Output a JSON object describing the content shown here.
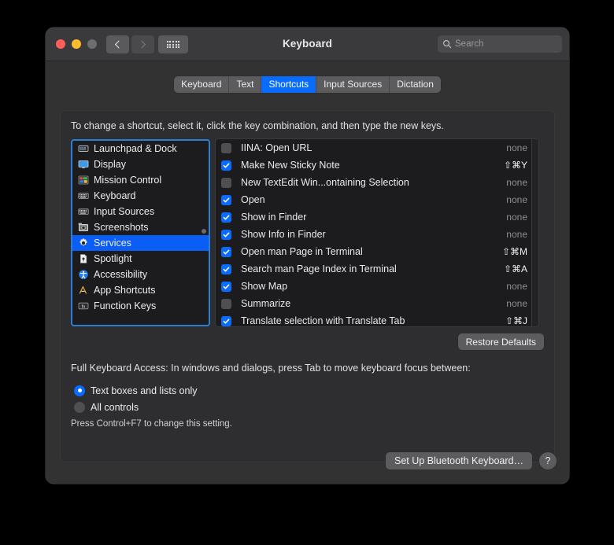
{
  "window": {
    "title": "Keyboard",
    "traffic_lights": [
      "close",
      "minimize",
      "zoom"
    ],
    "nav_back": "back-chevron",
    "nav_forward": "forward-chevron",
    "grid_button": "show-all-preferences"
  },
  "search": {
    "placeholder": "Search",
    "value": ""
  },
  "tabs": [
    {
      "label": "Keyboard",
      "active": false
    },
    {
      "label": "Text",
      "active": false
    },
    {
      "label": "Shortcuts",
      "active": true
    },
    {
      "label": "Input Sources",
      "active": false
    },
    {
      "label": "Dictation",
      "active": false
    }
  ],
  "hint": "To change a shortcut, select it, click the key combination, and then type the new keys.",
  "sidebar": {
    "items": [
      {
        "label": "Launchpad & Dock",
        "icon": "launchpad-icon",
        "selected": false
      },
      {
        "label": "Display",
        "icon": "display-icon",
        "selected": false
      },
      {
        "label": "Mission Control",
        "icon": "mission-control-icon",
        "selected": false
      },
      {
        "label": "Keyboard",
        "icon": "keyboard-icon",
        "selected": false
      },
      {
        "label": "Input Sources",
        "icon": "input-sources-icon",
        "selected": false
      },
      {
        "label": "Screenshots",
        "icon": "screenshots-icon",
        "selected": false
      },
      {
        "label": "Services",
        "icon": "gear-icon",
        "selected": true
      },
      {
        "label": "Spotlight",
        "icon": "spotlight-document-icon",
        "selected": false
      },
      {
        "label": "Accessibility",
        "icon": "accessibility-icon",
        "selected": false
      },
      {
        "label": "App Shortcuts",
        "icon": "app-shortcuts-icon",
        "selected": false
      },
      {
        "label": "Function Keys",
        "icon": "fn-key-icon",
        "selected": false
      }
    ]
  },
  "shortcuts": {
    "rows": [
      {
        "checked": false,
        "name": "IINA: Open URL",
        "value": "none",
        "assigned": false
      },
      {
        "checked": true,
        "name": "Make New Sticky Note",
        "value": "⇧⌘Y",
        "assigned": true
      },
      {
        "checked": false,
        "name": "New TextEdit Win...ontaining Selection",
        "value": "none",
        "assigned": false
      },
      {
        "checked": true,
        "name": "Open",
        "value": "none",
        "assigned": false
      },
      {
        "checked": true,
        "name": "Show in Finder",
        "value": "none",
        "assigned": false
      },
      {
        "checked": true,
        "name": "Show Info in Finder",
        "value": "none",
        "assigned": false
      },
      {
        "checked": true,
        "name": "Open man Page in Terminal",
        "value": "⇧⌘M",
        "assigned": true
      },
      {
        "checked": true,
        "name": "Search man Page Index in Terminal",
        "value": "⇧⌘A",
        "assigned": true
      },
      {
        "checked": true,
        "name": "Show Map",
        "value": "none",
        "assigned": false
      },
      {
        "checked": false,
        "name": "Summarize",
        "value": "none",
        "assigned": false
      },
      {
        "checked": true,
        "name": "Translate selection with Translate Tab",
        "value": "⇧⌘J",
        "assigned": true
      }
    ]
  },
  "restore_defaults_label": "Restore Defaults",
  "full_keyboard_access": {
    "heading": "Full Keyboard Access: In windows and dialogs, press Tab to move keyboard focus between:",
    "options": [
      {
        "label": "Text boxes and lists only",
        "selected": true
      },
      {
        "label": "All controls",
        "selected": false
      }
    ],
    "note": "Press Control+F7 to change this setting."
  },
  "footer": {
    "bluetooth_label": "Set Up Bluetooth Keyboard…",
    "help_label": "?"
  },
  "colors": {
    "accent": "#0a6cff",
    "selection": "#0a5ef5",
    "focus_ring": "#2b7ed8",
    "window_bg": "#323233",
    "panel_bg": "#2e2e30",
    "list_bg": "#1c1c1e"
  }
}
